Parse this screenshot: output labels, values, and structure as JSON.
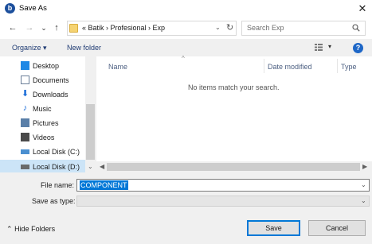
{
  "window": {
    "title": "Save As",
    "app_icon_letter": "b"
  },
  "nav": {
    "back": "←",
    "forward": "→",
    "history": "⌄",
    "up": "↑",
    "breadcrumb": "«  Batik  ›  Profesional  ›  Exp",
    "search_placeholder": "Search Exp"
  },
  "toolbar": {
    "organize": "Organize ▾",
    "new_folder": "New folder"
  },
  "sidebar": {
    "items": [
      {
        "label": "Desktop",
        "icon": "desktop-icon",
        "color": "#1e88e5"
      },
      {
        "label": "Documents",
        "icon": "documents-icon",
        "color": "#6b7f99"
      },
      {
        "label": "Downloads",
        "icon": "downloads-icon",
        "color": "#1e6fd9"
      },
      {
        "label": "Music",
        "icon": "music-icon",
        "color": "#1e6fd9"
      },
      {
        "label": "Pictures",
        "icon": "pictures-icon",
        "color": "#5a7fa8"
      },
      {
        "label": "Videos",
        "icon": "videos-icon",
        "color": "#4a4a4a"
      },
      {
        "label": "Local Disk (C:)",
        "icon": "drive-icon",
        "color": "#4a8fd0"
      },
      {
        "label": "Local Disk (D:)",
        "icon": "drive-icon",
        "color": "#6a6a6a"
      }
    ]
  },
  "list": {
    "columns": [
      "Name",
      "Date modified",
      "Type"
    ],
    "empty_message": "No items match your search."
  },
  "form": {
    "file_name_label": "File name:",
    "file_name_value": "COMPONENT",
    "save_as_type_label": "Save as type:",
    "save_as_type_value": ""
  },
  "footer": {
    "hide_folders": "Hide Folders",
    "save": "Save",
    "cancel": "Cancel"
  },
  "colors": {
    "accent": "#0078d7",
    "selection": "#cce4f7"
  }
}
